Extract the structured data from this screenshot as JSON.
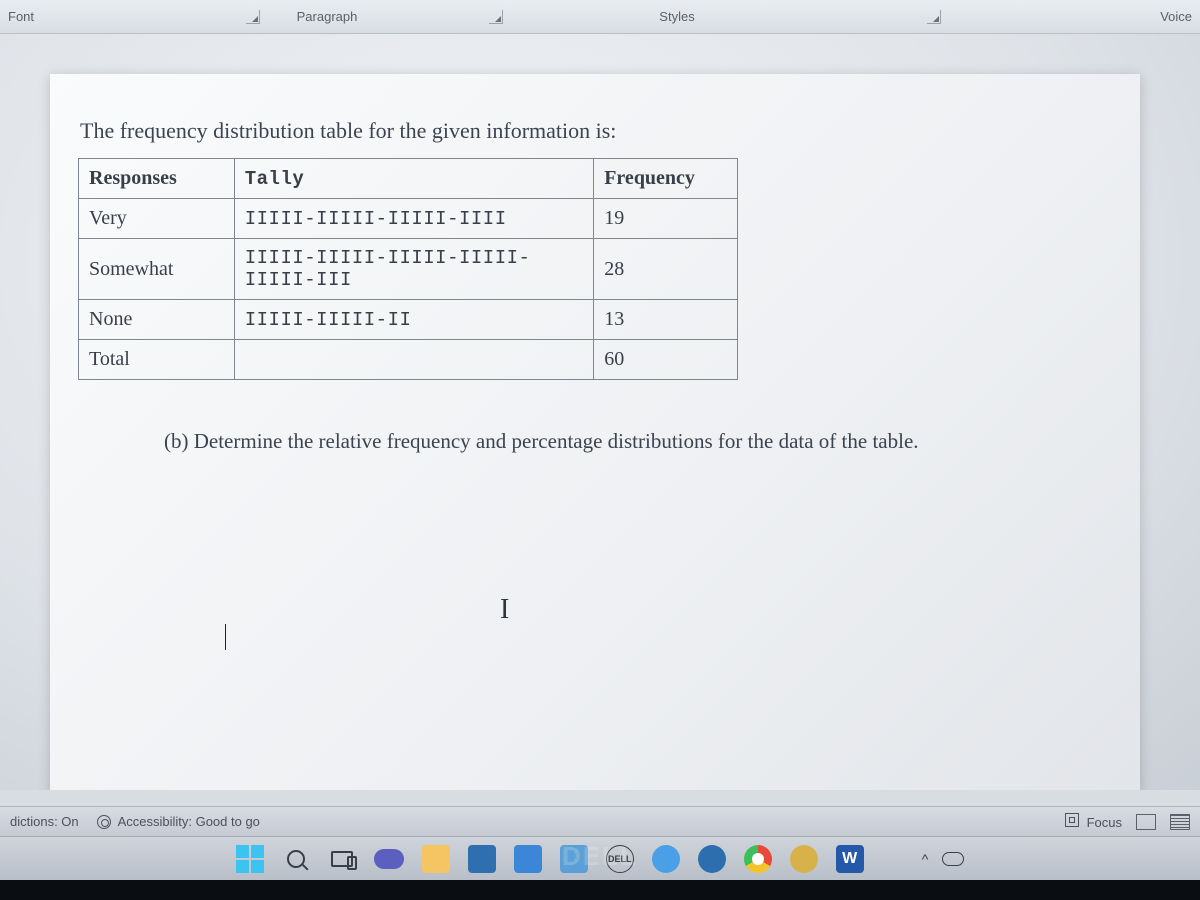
{
  "ribbon": {
    "font_label": "Font",
    "paragraph_label": "Paragraph",
    "styles_label": "Styles",
    "voice_label": "Voice"
  },
  "document": {
    "intro": "The frequency distribution table for the given information is:",
    "headers": {
      "responses": "Responses",
      "tally": "Tally",
      "frequency": "Frequency"
    },
    "rows": [
      {
        "response": "Very",
        "tally": "IIIII-IIIII-IIIII-IIII",
        "frequency": "19"
      },
      {
        "response": "Somewhat",
        "tally": "IIIII-IIIII-IIIII-IIIII-IIIII-III",
        "frequency": "28"
      },
      {
        "response": "None",
        "tally": "IIIII-IIIII-II",
        "frequency": "13"
      },
      {
        "response": "Total",
        "tally": "",
        "frequency": "60"
      }
    ],
    "question_b": "(b) Determine the relative frequency and percentage distributions for the data of the table.",
    "cursor_glyph": "I"
  },
  "statusbar": {
    "predictions": "dictions: On",
    "accessibility": "Accessibility: Good to go",
    "focus": "Focus"
  },
  "taskbar": {
    "word_letter": "W",
    "dell_text": "DELL"
  },
  "watermark": "DELL"
}
